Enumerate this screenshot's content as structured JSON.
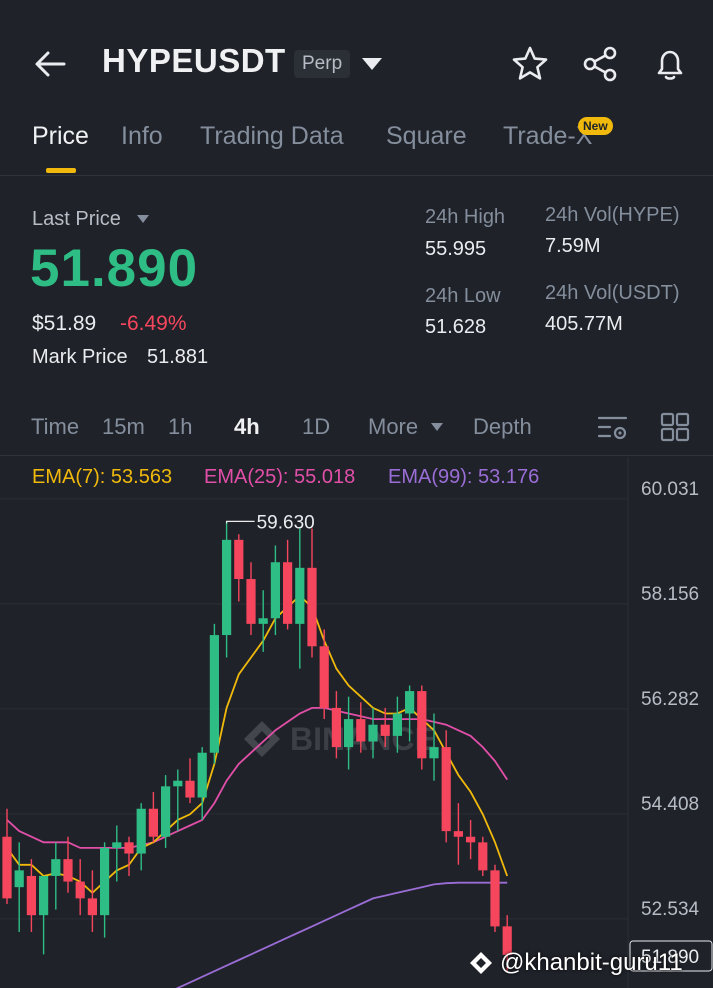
{
  "header": {
    "symbol": "HYPEUSDT",
    "contract_type": "Perp",
    "icons": [
      "back-arrow-icon",
      "dropdown-triangle-icon",
      "star-icon",
      "share-icon",
      "bell-icon"
    ]
  },
  "tabs": [
    {
      "label": "Price",
      "active": true
    },
    {
      "label": "Info",
      "active": false
    },
    {
      "label": "Trading Data",
      "active": false
    },
    {
      "label": "Square",
      "active": false
    },
    {
      "label": "Trade-X",
      "active": false,
      "badge": "New"
    }
  ],
  "stats": {
    "last_price_label": "Last Price",
    "last_price": "51.890",
    "usd_price": "$51.89",
    "change": "-6.49%",
    "mark_price_label": "Mark Price",
    "mark_price": "51.881",
    "high_label": "24h High",
    "high": "55.995",
    "low_label": "24h Low",
    "low": "51.628",
    "vol_base_label": "24h Vol(HYPE)",
    "vol_base": "7.59M",
    "vol_quote_label": "24h Vol(USDT)",
    "vol_quote": "405.77M"
  },
  "timeframes": {
    "items": [
      "Time",
      "15m",
      "1h",
      "4h",
      "1D",
      "More",
      "Depth"
    ],
    "active": "4h"
  },
  "ema": {
    "ema7": "EMA(7): 53.563",
    "ema25": "EMA(25): 55.018",
    "ema99": "EMA(99): 53.176"
  },
  "colors": {
    "up": "#2ebd85",
    "down": "#f6465d",
    "ema7": "#f0b90b",
    "ema25": "#e24fa8",
    "ema99": "#9b6dd6",
    "accent": "#f0b90b"
  },
  "chart_data": {
    "type": "candlestick",
    "y_ticks": [
      "60.031",
      "58.156",
      "56.282",
      "54.408",
      "52.534",
      "51.890"
    ],
    "ylim": [
      51.3,
      60.6
    ],
    "high_annotation": "59.630",
    "watermark": "BINANCE",
    "candles": [
      {
        "o": 54.0,
        "h": 54.5,
        "l": 52.8,
        "c": 52.9
      },
      {
        "o": 53.1,
        "h": 53.9,
        "l": 52.3,
        "c": 53.4
      },
      {
        "o": 53.3,
        "h": 53.6,
        "l": 52.3,
        "c": 52.6
      },
      {
        "o": 52.6,
        "h": 53.3,
        "l": 51.9,
        "c": 53.3
      },
      {
        "o": 53.3,
        "h": 53.9,
        "l": 52.7,
        "c": 53.6
      },
      {
        "o": 53.6,
        "h": 54.0,
        "l": 53.0,
        "c": 53.2
      },
      {
        "o": 53.2,
        "h": 53.6,
        "l": 52.6,
        "c": 52.9
      },
      {
        "o": 52.9,
        "h": 53.4,
        "l": 52.3,
        "c": 52.6
      },
      {
        "o": 52.6,
        "h": 53.9,
        "l": 52.2,
        "c": 53.8
      },
      {
        "o": 53.8,
        "h": 54.2,
        "l": 53.2,
        "c": 53.9
      },
      {
        "o": 53.9,
        "h": 54.0,
        "l": 53.3,
        "c": 53.7
      },
      {
        "o": 53.7,
        "h": 54.6,
        "l": 53.4,
        "c": 54.5
      },
      {
        "o": 54.5,
        "h": 54.8,
        "l": 53.9,
        "c": 54.0
      },
      {
        "o": 54.0,
        "h": 55.1,
        "l": 53.8,
        "c": 54.9
      },
      {
        "o": 54.9,
        "h": 55.2,
        "l": 54.1,
        "c": 55.0
      },
      {
        "o": 55.0,
        "h": 55.4,
        "l": 54.6,
        "c": 54.7
      },
      {
        "o": 54.7,
        "h": 55.6,
        "l": 54.3,
        "c": 55.5
      },
      {
        "o": 55.5,
        "h": 57.8,
        "l": 55.3,
        "c": 57.6
      },
      {
        "o": 57.6,
        "h": 59.63,
        "l": 57.2,
        "c": 59.3
      },
      {
        "o": 59.3,
        "h": 59.4,
        "l": 58.2,
        "c": 58.6
      },
      {
        "o": 58.6,
        "h": 58.9,
        "l": 57.6,
        "c": 57.8
      },
      {
        "o": 57.8,
        "h": 58.4,
        "l": 57.3,
        "c": 57.9
      },
      {
        "o": 57.9,
        "h": 59.2,
        "l": 57.6,
        "c": 58.9
      },
      {
        "o": 58.9,
        "h": 59.3,
        "l": 57.7,
        "c": 57.8
      },
      {
        "o": 57.8,
        "h": 59.5,
        "l": 57.0,
        "c": 58.8
      },
      {
        "o": 58.8,
        "h": 59.5,
        "l": 57.2,
        "c": 57.4
      },
      {
        "o": 57.4,
        "h": 57.7,
        "l": 56.1,
        "c": 56.3
      },
      {
        "o": 56.3,
        "h": 56.6,
        "l": 55.4,
        "c": 55.6
      },
      {
        "o": 55.6,
        "h": 56.5,
        "l": 55.2,
        "c": 56.1
      },
      {
        "o": 56.1,
        "h": 56.4,
        "l": 55.5,
        "c": 55.7
      },
      {
        "o": 55.7,
        "h": 56.3,
        "l": 55.4,
        "c": 56.0
      },
      {
        "o": 56.0,
        "h": 56.3,
        "l": 55.6,
        "c": 55.8
      },
      {
        "o": 55.8,
        "h": 56.5,
        "l": 55.5,
        "c": 56.2
      },
      {
        "o": 56.2,
        "h": 56.7,
        "l": 55.7,
        "c": 56.6
      },
      {
        "o": 56.6,
        "h": 56.7,
        "l": 55.2,
        "c": 55.4
      },
      {
        "o": 55.4,
        "h": 56.2,
        "l": 55.0,
        "c": 55.6
      },
      {
        "o": 55.6,
        "h": 55.9,
        "l": 53.9,
        "c": 54.1
      },
      {
        "o": 54.1,
        "h": 54.6,
        "l": 53.5,
        "c": 54.0
      },
      {
        "o": 54.0,
        "h": 54.3,
        "l": 53.6,
        "c": 53.9
      },
      {
        "o": 53.9,
        "h": 54.0,
        "l": 53.3,
        "c": 53.4
      },
      {
        "o": 53.4,
        "h": 53.5,
        "l": 52.3,
        "c": 52.4
      },
      {
        "o": 52.4,
        "h": 52.6,
        "l": 51.6,
        "c": 51.89
      }
    ],
    "ema7": [
      53.8,
      53.5,
      53.5,
      53.3,
      53.35,
      53.3,
      53.2,
      53.0,
      53.2,
      53.4,
      53.5,
      53.8,
      53.9,
      54.1,
      54.3,
      54.4,
      54.6,
      55.3,
      56.3,
      56.9,
      57.2,
      57.5,
      57.9,
      58.1,
      58.3,
      58.1,
      57.5,
      57.0,
      56.7,
      56.5,
      56.3,
      56.2,
      56.2,
      56.3,
      56.1,
      55.9,
      55.5,
      55.1,
      54.8,
      54.4,
      53.9,
      53.3
    ],
    "ema25": [
      54.3,
      54.1,
      54.0,
      53.9,
      53.9,
      53.9,
      53.8,
      53.8,
      53.8,
      53.8,
      53.8,
      53.85,
      53.9,
      54.0,
      54.1,
      54.2,
      54.3,
      54.6,
      55.0,
      55.3,
      55.5,
      55.7,
      55.9,
      56.05,
      56.2,
      56.3,
      56.3,
      56.25,
      56.2,
      56.15,
      56.1,
      56.1,
      56.1,
      56.1,
      56.1,
      56.05,
      56.0,
      55.9,
      55.8,
      55.6,
      55.35,
      55.02
    ],
    "ema99": [
      50.9,
      51.0,
      51.1,
      51.2,
      51.3,
      51.4,
      51.5,
      51.6,
      51.7,
      51.8,
      51.9,
      52.0,
      52.1,
      52.2,
      52.3,
      52.4,
      52.5,
      52.6,
      52.7,
      52.8,
      52.9,
      52.95,
      53.0,
      53.05,
      53.1,
      53.15,
      53.17,
      53.18,
      53.18,
      53.18,
      53.18,
      53.18
    ]
  },
  "watermark": {
    "handle": "@khanbit-guru11"
  }
}
